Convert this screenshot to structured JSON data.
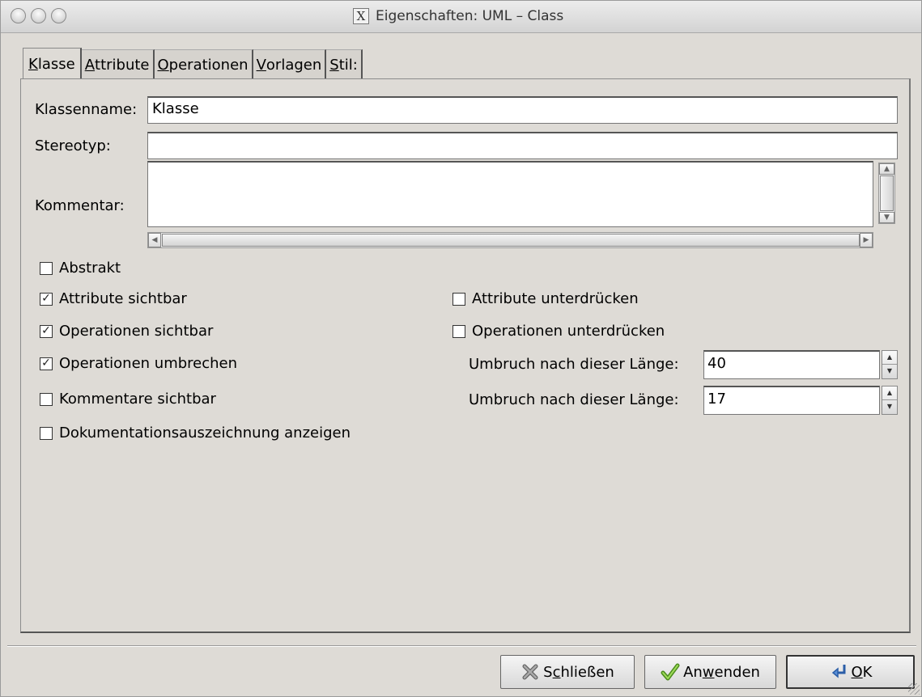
{
  "window": {
    "title": "Eigenschaften: UML – Class",
    "title_icon": "X"
  },
  "tabs": [
    {
      "u": "K",
      "rest": "lasse"
    },
    {
      "u": "A",
      "rest": "ttribute"
    },
    {
      "u": "O",
      "rest": "perationen"
    },
    {
      "u": "V",
      "rest": "orlagen"
    },
    {
      "u": "S",
      "rest": "til:"
    }
  ],
  "form": {
    "classname_label": "Klassenname:",
    "classname_value": "Klasse",
    "stereotype_label": "Stereotyp:",
    "stereotype_value": "",
    "comment_label": "Kommentar:"
  },
  "checkboxes": {
    "abstract": {
      "label": "Abstrakt",
      "checked": false,
      "mark": ""
    },
    "attributes_visible": {
      "label": "Attribute sichtbar",
      "checked": true,
      "mark": "✓"
    },
    "operations_visible": {
      "label": "Operationen sichtbar",
      "checked": true,
      "mark": "✓"
    },
    "operations_wrap": {
      "label": "Operationen umbrechen",
      "checked": true,
      "mark": "✓"
    },
    "comments_visible": {
      "label": "Kommentare sichtbar",
      "checked": false,
      "mark": ""
    },
    "doc_tag": {
      "label": "Dokumentationsauszeichnung anzeigen",
      "checked": false,
      "mark": ""
    },
    "attributes_suppress": {
      "label": "Attribute unterdrücken",
      "checked": false,
      "mark": ""
    },
    "operations_suppress": {
      "label": "Operationen unterdrücken",
      "checked": false,
      "mark": ""
    }
  },
  "wrap": {
    "operations_label": "Umbruch nach dieser Länge:",
    "operations_value": "40",
    "comments_label": "Umbruch nach dieser Länge:",
    "comments_value": "17"
  },
  "buttons": {
    "close": {
      "pre": "S",
      "u": "c",
      "post": "hließen"
    },
    "apply": {
      "pre": "An",
      "u": "w",
      "post": "enden"
    },
    "ok": {
      "pre": "",
      "u": "O",
      "post": "K"
    }
  },
  "icons": {
    "close": "close-x-icon",
    "apply": "checkmark-icon",
    "ok": "enter-arrow-icon"
  }
}
